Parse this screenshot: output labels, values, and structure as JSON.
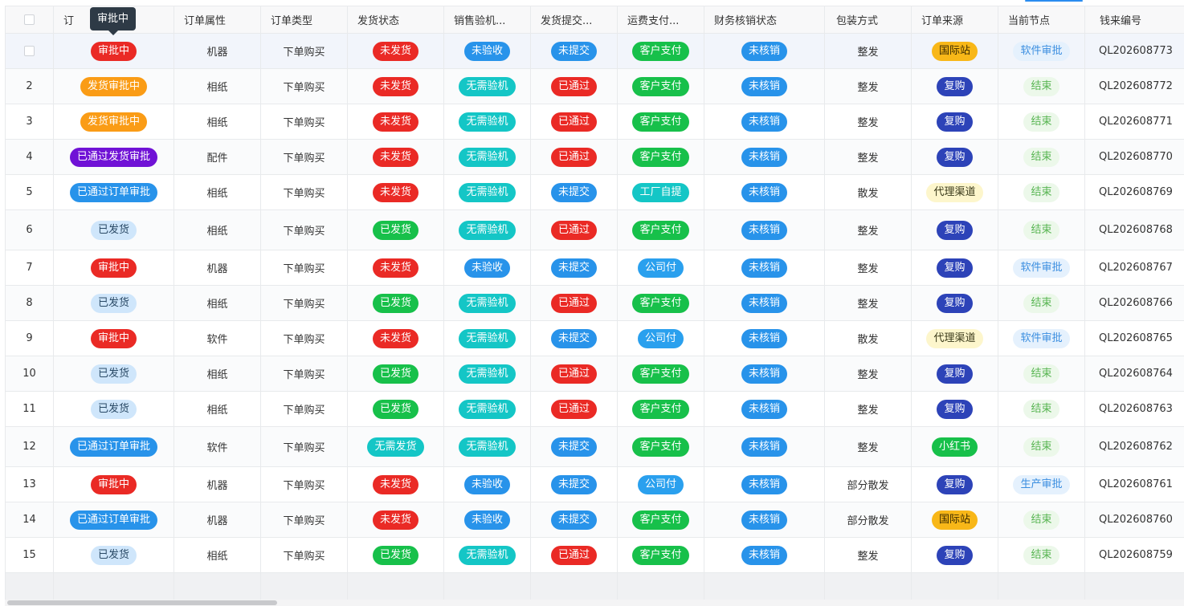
{
  "tooltip": {
    "text": "审批中"
  },
  "columns": {
    "order_status": "订",
    "order_attr": "订单属性",
    "order_type": "订单类型",
    "ship_status": "发货状态",
    "sales_check": "销售验机...",
    "ship_submit": "发货提交...",
    "freight": "运费支付...",
    "finance": "财务核销状态",
    "packing": "包装方式",
    "source": "订单来源",
    "node": "当前节点",
    "qian_no": "钱来编号"
  },
  "tag_colors": {
    "red": "#ea2a25",
    "orange": "#fa9c16",
    "purple": "#7012d6",
    "blue": "#2893ea",
    "green": "#17c04a",
    "teal": "#14c6c6",
    "navy": "#2d43b8",
    "gold": "#f8b718"
  },
  "rows": [
    {
      "no": "",
      "status": "审批中",
      "attr": "机器",
      "type": "下单购买",
      "ship": "未发货",
      "sales": "未验收",
      "submit": "未提交",
      "freight": "客户支付",
      "finance": "未核销",
      "pack": "整发",
      "source": "国际站",
      "node": "软件审批",
      "qian": "QL202608773"
    },
    {
      "no": "2",
      "status": "发货审批中",
      "attr": "相纸",
      "type": "下单购买",
      "ship": "未发货",
      "sales": "无需验机",
      "submit": "已通过",
      "freight": "客户支付",
      "finance": "未核销",
      "pack": "整发",
      "source": "复购",
      "node": "结束",
      "qian": "QL202608772"
    },
    {
      "no": "3",
      "status": "发货审批中",
      "attr": "相纸",
      "type": "下单购买",
      "ship": "未发货",
      "sales": "无需验机",
      "submit": "已通过",
      "freight": "客户支付",
      "finance": "未核销",
      "pack": "整发",
      "source": "复购",
      "node": "结束",
      "qian": "QL202608771"
    },
    {
      "no": "4",
      "status": "已通过发货审批",
      "attr": "配件",
      "type": "下单购买",
      "ship": "未发货",
      "sales": "无需验机",
      "submit": "已通过",
      "freight": "客户支付",
      "finance": "未核销",
      "pack": "整发",
      "source": "复购",
      "node": "结束",
      "qian": "QL202608770"
    },
    {
      "no": "5",
      "status": "已通过订单审批",
      "attr": "相纸",
      "type": "下单购买",
      "ship": "未发货",
      "sales": "无需验机",
      "submit": "未提交",
      "freight": "工厂自提",
      "finance": "未核销",
      "pack": "散发",
      "source": "代理渠道",
      "node": "结束",
      "qian": "QL202608769"
    },
    {
      "no": "6",
      "status": "已发货",
      "attr": "相纸",
      "type": "下单购买",
      "ship": "已发货",
      "sales": "无需验机",
      "submit": "已通过",
      "freight": "客户支付",
      "finance": "未核销",
      "pack": "整发",
      "source": "复购",
      "node": "结束",
      "qian": "QL202608768"
    },
    {
      "no": "7",
      "status": "审批中",
      "attr": "机器",
      "type": "下单购买",
      "ship": "未发货",
      "sales": "未验收",
      "submit": "未提交",
      "freight": "公司付",
      "finance": "未核销",
      "pack": "整发",
      "source": "复购",
      "node": "软件审批",
      "qian": "QL202608767"
    },
    {
      "no": "8",
      "status": "已发货",
      "attr": "相纸",
      "type": "下单购买",
      "ship": "已发货",
      "sales": "无需验机",
      "submit": "已通过",
      "freight": "客户支付",
      "finance": "未核销",
      "pack": "整发",
      "source": "复购",
      "node": "结束",
      "qian": "QL202608766"
    },
    {
      "no": "9",
      "status": "审批中",
      "attr": "软件",
      "type": "下单购买",
      "ship": "未发货",
      "sales": "无需验机",
      "submit": "未提交",
      "freight": "公司付",
      "finance": "未核销",
      "pack": "散发",
      "source": "代理渠道",
      "node": "软件审批",
      "qian": "QL202608765"
    },
    {
      "no": "10",
      "status": "已发货",
      "attr": "相纸",
      "type": "下单购买",
      "ship": "已发货",
      "sales": "无需验机",
      "submit": "已通过",
      "freight": "客户支付",
      "finance": "未核销",
      "pack": "整发",
      "source": "复购",
      "node": "结束",
      "qian": "QL202608764"
    },
    {
      "no": "11",
      "status": "已发货",
      "attr": "相纸",
      "type": "下单购买",
      "ship": "已发货",
      "sales": "无需验机",
      "submit": "已通过",
      "freight": "客户支付",
      "finance": "未核销",
      "pack": "整发",
      "source": "复购",
      "node": "结束",
      "qian": "QL202608763"
    },
    {
      "no": "12",
      "status": "已通过订单审批",
      "attr": "软件",
      "type": "下单购买",
      "ship": "无需发货",
      "sales": "无需验机",
      "submit": "未提交",
      "freight": "客户支付",
      "finance": "未核销",
      "pack": "整发",
      "source": "小红书",
      "node": "结束",
      "qian": "QL202608762"
    },
    {
      "no": "13",
      "status": "审批中",
      "attr": "机器",
      "type": "下单购买",
      "ship": "未发货",
      "sales": "未验收",
      "submit": "未提交",
      "freight": "公司付",
      "finance": "未核销",
      "pack": "部分散发",
      "source": "复购",
      "node": "生产审批",
      "qian": "QL202608761"
    },
    {
      "no": "14",
      "status": "已通过订单审批",
      "attr": "机器",
      "type": "下单购买",
      "ship": "未发货",
      "sales": "未验收",
      "submit": "未提交",
      "freight": "客户支付",
      "finance": "未核销",
      "pack": "部分散发",
      "source": "国际站",
      "node": "结束",
      "qian": "QL202608760"
    },
    {
      "no": "15",
      "status": "已发货",
      "attr": "相纸",
      "type": "下单购买",
      "ship": "已发货",
      "sales": "无需验机",
      "submit": "已通过",
      "freight": "客户支付",
      "finance": "未核销",
      "pack": "整发",
      "source": "复购",
      "node": "结束",
      "qian": "QL202608759"
    }
  ]
}
